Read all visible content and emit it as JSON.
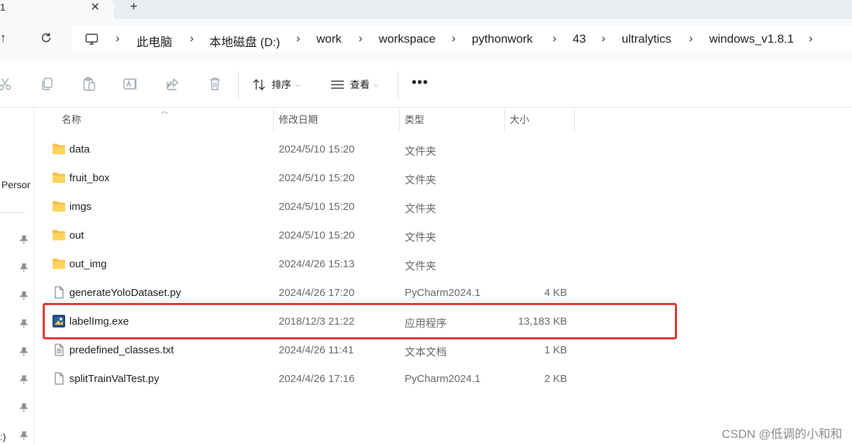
{
  "tab": {
    "title": "1",
    "close": "✕",
    "new": "+"
  },
  "nav": {
    "up": "↑"
  },
  "breadcrumb": [
    "此电脑",
    "本地磁盘 (D:)",
    "work",
    "workspace",
    "pythonwork",
    "43",
    "ultralytics",
    "windows_v1.8.1"
  ],
  "toolbar": {
    "sort_label": "排序",
    "view_label": "查看",
    "more_label": "•••"
  },
  "navpane": {
    "item_text": "Persor",
    "bottom_text": ":)"
  },
  "columns": {
    "name": "名称",
    "date": "修改日期",
    "type": "类型",
    "size": "大小"
  },
  "files": [
    {
      "name": "data",
      "date": "2024/5/10 15:20",
      "type": "文件夹",
      "size": "",
      "icon": "folder-icon"
    },
    {
      "name": "fruit_box",
      "date": "2024/5/10 15:20",
      "type": "文件夹",
      "size": "",
      "icon": "folder-icon"
    },
    {
      "name": "imgs",
      "date": "2024/5/10 15:20",
      "type": "文件夹",
      "size": "",
      "icon": "folder-icon"
    },
    {
      "name": "out",
      "date": "2024/5/10 15:20",
      "type": "文件夹",
      "size": "",
      "icon": "folder-icon"
    },
    {
      "name": "out_img",
      "date": "2024/4/26 15:13",
      "type": "文件夹",
      "size": "",
      "icon": "folder-icon"
    },
    {
      "name": "generateYoloDataset.py",
      "date": "2024/4/26 17:20",
      "type": "PyCharm2024.1",
      "size": "4 KB",
      "icon": "file-icon"
    },
    {
      "name": "labelImg.exe",
      "date": "2018/12/3 21:22",
      "type": "应用程序",
      "size": "13,183 KB",
      "icon": "app-icon"
    },
    {
      "name": "predefined_classes.txt",
      "date": "2024/4/26 11:41",
      "type": "文本文档",
      "size": "1 KB",
      "icon": "text-file-icon"
    },
    {
      "name": "splitTrainValTest.py",
      "date": "2024/4/26 17:16",
      "type": "PyCharm2024.1",
      "size": "2 KB",
      "icon": "file-icon"
    }
  ],
  "watermark": "CSDN @低调的小和和",
  "colors": {
    "highlight": "#e23232",
    "folder": "#f5c04a"
  }
}
